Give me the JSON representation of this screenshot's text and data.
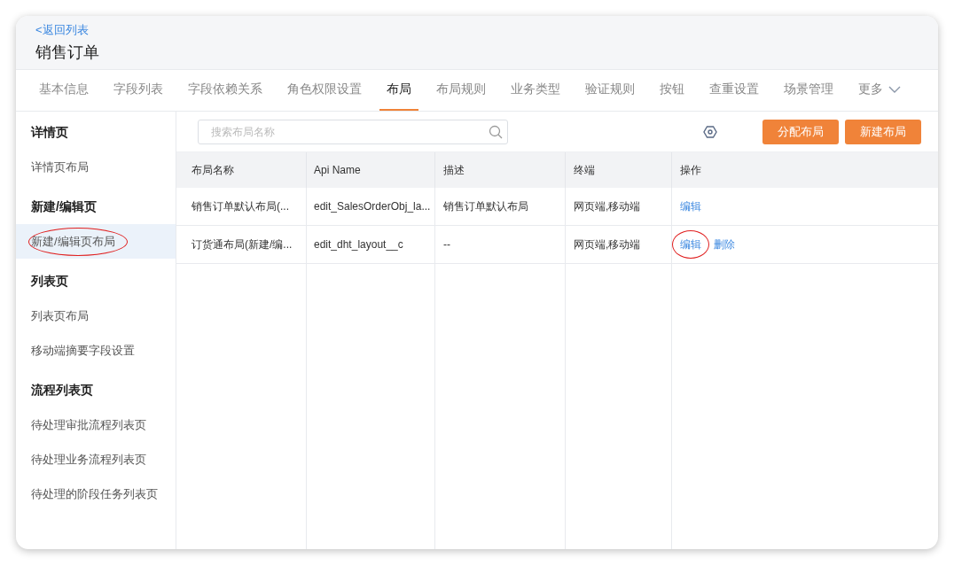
{
  "header": {
    "back_link": "<返回列表",
    "title": "销售订单"
  },
  "tabs": [
    {
      "label": "基本信息",
      "selected": false
    },
    {
      "label": "字段列表",
      "selected": false
    },
    {
      "label": "字段依赖关系",
      "selected": false
    },
    {
      "label": "角色权限设置",
      "selected": false
    },
    {
      "label": "布局",
      "selected": true
    },
    {
      "label": "布局规则",
      "selected": false
    },
    {
      "label": "业务类型",
      "selected": false
    },
    {
      "label": "验证规则",
      "selected": false
    },
    {
      "label": "按钮",
      "selected": false
    },
    {
      "label": "查重设置",
      "selected": false
    },
    {
      "label": "场景管理",
      "selected": false
    },
    {
      "label": "更多",
      "selected": false
    }
  ],
  "sidebar": {
    "groups": [
      {
        "title": "详情页",
        "items": [
          {
            "label": "详情页布局",
            "selected": false,
            "annotated": false
          }
        ]
      },
      {
        "title": "新建/编辑页",
        "items": [
          {
            "label": "新建/编辑页布局",
            "selected": true,
            "annotated": true
          }
        ]
      },
      {
        "title": "列表页",
        "items": [
          {
            "label": "列表页布局",
            "selected": false,
            "annotated": false
          },
          {
            "label": "移动端摘要字段设置",
            "selected": false,
            "annotated": false
          }
        ]
      },
      {
        "title": "流程列表页",
        "items": [
          {
            "label": "待处理审批流程列表页",
            "selected": false,
            "annotated": false
          },
          {
            "label": "待处理业务流程列表页",
            "selected": false,
            "annotated": false
          },
          {
            "label": "待处理的阶段任务列表页",
            "selected": false,
            "annotated": false
          }
        ]
      }
    ]
  },
  "toolbar": {
    "search": {
      "placeholder": "搜索布局名称"
    },
    "buttons": [
      "分配布局",
      "新建布局"
    ]
  },
  "table": {
    "columns": [
      "布局名称",
      "Api Name",
      "描述",
      "终端",
      "操作"
    ],
    "rows": [
      {
        "cells": [
          "销售订单默认布局(...",
          "edit_SalesOrderObj_la...",
          "销售订单默认布局",
          "网页端,移动端"
        ],
        "actions": [
          {
            "label": "编辑",
            "annotated": false
          }
        ]
      },
      {
        "cells": [
          "订货通布局(新建/编...",
          "edit_dht_layout__c",
          "--",
          "网页端,移动端"
        ],
        "actions": [
          {
            "label": "编辑",
            "annotated": true
          },
          {
            "label": "删除",
            "annotated": false
          }
        ]
      }
    ]
  }
}
